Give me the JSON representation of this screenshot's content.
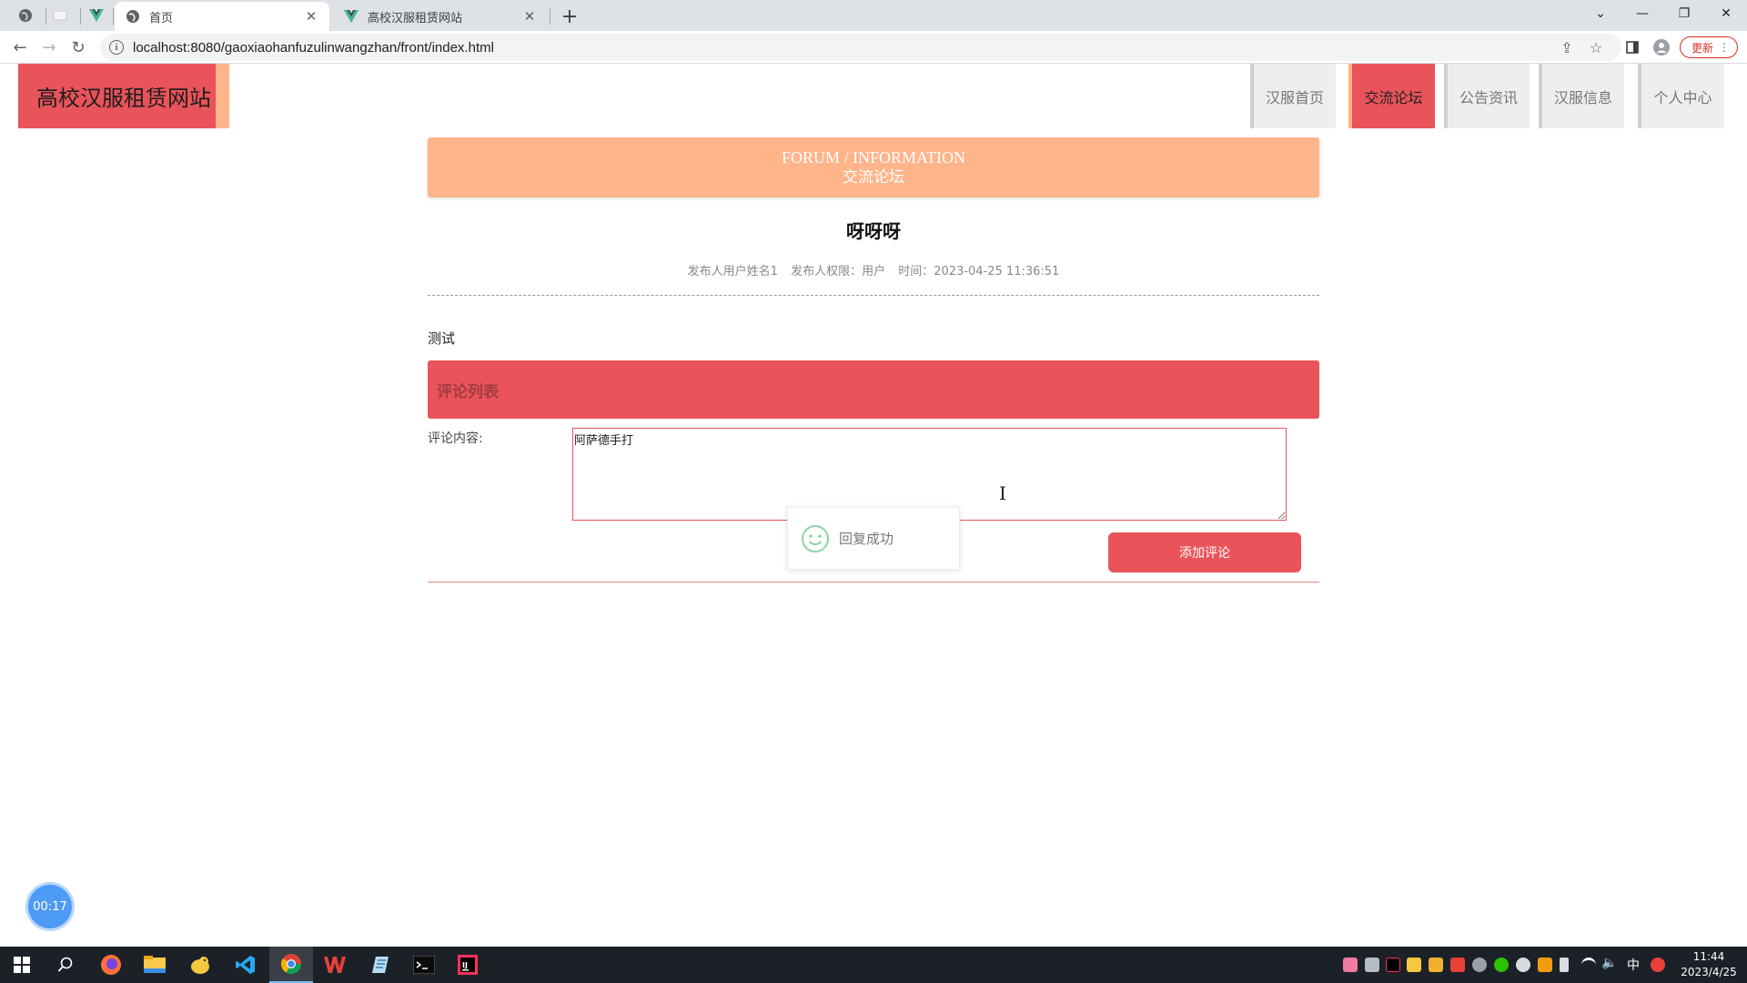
{
  "browser": {
    "tabs": [
      {
        "title": "首页",
        "active": true
      },
      {
        "title": "高校汉服租赁网站",
        "active": false
      }
    ],
    "address_bar": {
      "url": "localhost:8080/gaoxiaohanfuzulinwangzhan/front/index.html"
    },
    "update_label": "更新"
  },
  "site": {
    "logo_text": "高校汉服租赁网站",
    "nav": [
      {
        "label": "汉服首页",
        "active": false
      },
      {
        "label": "交流论坛",
        "active": true
      },
      {
        "label": "公告资讯",
        "active": false
      },
      {
        "label": "汉服信息",
        "active": false
      },
      {
        "label": "个人中心",
        "active": false
      }
    ]
  },
  "forum": {
    "banner_en": "FORUM / INFORMATION",
    "banner_cn": "交流论坛",
    "post_title": "呀呀呀",
    "meta": {
      "author": "发布人用户姓名1",
      "role": "发布人权限：用户",
      "time": "时间：2023-04-25 11:36:51"
    },
    "body": "测试",
    "comment_section_title": "评论列表",
    "comment_label": "评论内容:",
    "comment_value": "阿萨德手打",
    "add_button": "添加评论"
  },
  "toast": {
    "message": "回复成功"
  },
  "timer": {
    "value": "00:17"
  },
  "taskbar": {
    "clock_time": "11:44",
    "clock_date": "2023/4/25",
    "ime": "中"
  },
  "colors": {
    "primary": "#e9535a",
    "accent": "#ffb48a"
  }
}
